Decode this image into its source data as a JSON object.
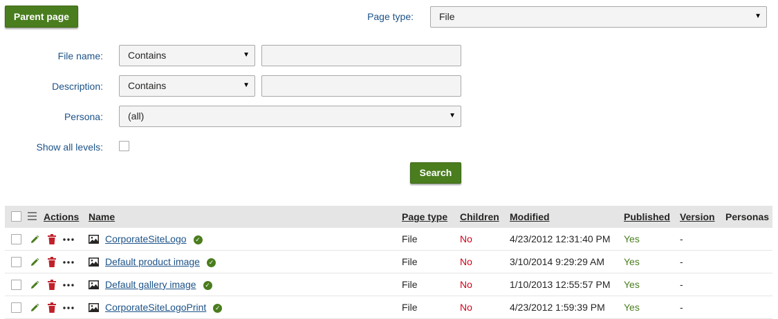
{
  "toolbar": {
    "parent_page_label": "Parent page"
  },
  "filters": {
    "page_type": {
      "label": "Page type:",
      "value": "File"
    },
    "file_name": {
      "label": "File name:",
      "operator": "Contains",
      "value": ""
    },
    "description": {
      "label": "Description:",
      "operator": "Contains",
      "value": ""
    },
    "persona": {
      "label": "Persona:",
      "value": "(all)"
    },
    "show_all_levels": {
      "label": "Show all levels:",
      "checked": false
    },
    "search_label": "Search"
  },
  "grid": {
    "columns": {
      "actions": "Actions",
      "name": "Name",
      "page_type": "Page type",
      "children": "Children",
      "modified": "Modified",
      "published": "Published",
      "version": "Version",
      "personas": "Personas"
    },
    "rows": [
      {
        "name": "CorporateSiteLogo",
        "page_type": "File",
        "children": "No",
        "modified": "4/23/2012 12:31:40 PM",
        "published": "Yes",
        "version": "-"
      },
      {
        "name": "Default product image",
        "page_type": "File",
        "children": "No",
        "modified": "3/10/2014 9:29:29 AM",
        "published": "Yes",
        "version": "-"
      },
      {
        "name": "Default gallery image",
        "page_type": "File",
        "children": "No",
        "modified": "1/10/2013 12:55:57 PM",
        "published": "Yes",
        "version": "-"
      },
      {
        "name": "CorporateSiteLogoPrint",
        "page_type": "File",
        "children": "No",
        "modified": "4/23/2012 1:59:39 PM",
        "published": "Yes",
        "version": "-"
      }
    ]
  },
  "icons": {
    "edit": "pencil-icon",
    "delete": "trash-icon",
    "more": "ellipsis-icon",
    "file": "image-icon",
    "status": "check-circle-icon",
    "columns": "menu-lines-icon",
    "dropdown": "caret-down-icon"
  },
  "colors": {
    "button_green": "#4a7d1e",
    "label_blue": "#1c5288",
    "no_red": "#d0021b",
    "delete_red": "#c0212b",
    "header_gray": "#e5e5e5"
  }
}
